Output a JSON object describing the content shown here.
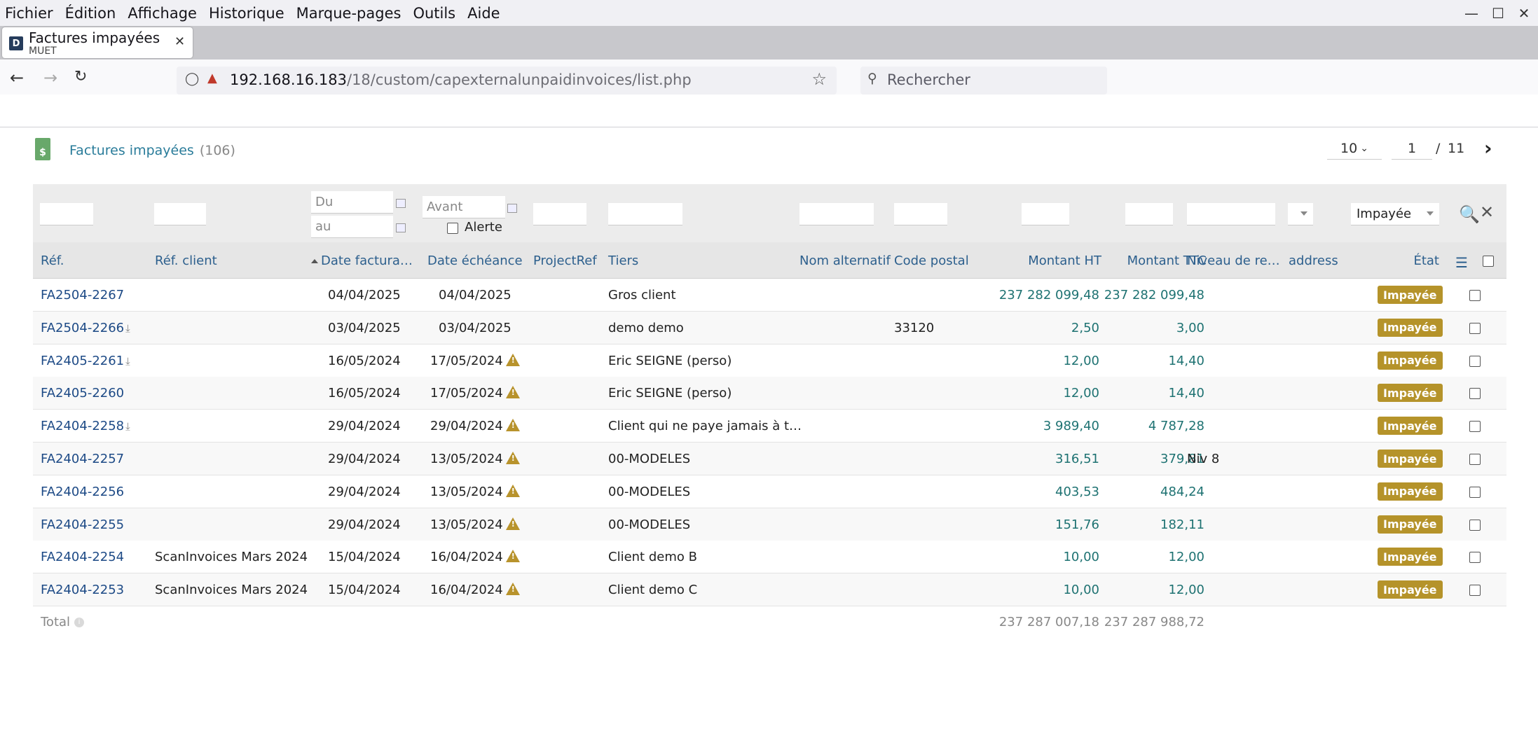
{
  "browser": {
    "menu": [
      "Fichier",
      "Édition",
      "Affichage",
      "Historique",
      "Marque-pages",
      "Outils",
      "Aide"
    ],
    "tab": {
      "title": "Factures impayées",
      "subtitle": "MUET",
      "favicon": "D"
    },
    "url": {
      "host": "192.168.16.183",
      "path": "/18/custom/capexternalunpaidinvoices/list.php"
    },
    "search_placeholder": "Rechercher",
    "icons": [
      "back-icon",
      "forward-icon",
      "reload-icon",
      "shield-icon",
      "lock-icon",
      "star-icon",
      "search-icon",
      "minimize-icon",
      "maximize-icon",
      "close-icon"
    ]
  },
  "page": {
    "title": "Factures impayées",
    "count": "(106)",
    "pagination": {
      "limit": "10",
      "page": "1",
      "separator": "/",
      "total_pages": "11"
    }
  },
  "filters": {
    "date_from_placeholder": "Du",
    "date_to_placeholder": "au",
    "due_before_placeholder": "Avant",
    "alert_label": "Alerte",
    "status_value": "Impayée"
  },
  "columns": {
    "ref": "Réf.",
    "ref_client": "Réf. client",
    "date_invoice": "Date factura…",
    "date_due": "Date échéance",
    "project_ref": "ProjectRef",
    "thirdparty": "Tiers",
    "alt_name": "Nom alternatif",
    "zip": "Code postal",
    "amount_ht": "Montant HT",
    "amount_ttc": "Montant TTC",
    "level": "Niveau de re…",
    "address": "address",
    "status": "État"
  },
  "rows": [
    {
      "ref": "FA2504-2267",
      "download": false,
      "ref_client": "",
      "date_invoice": "04/04/2025",
      "date_due": "04/04/2025",
      "warn": false,
      "thirdparty": "Gros client",
      "zip": "",
      "amount_ht": "237 282 099,48",
      "amount_ttc": "237 282 099,48",
      "level": "",
      "status": "Impayée"
    },
    {
      "ref": "FA2504-2266",
      "download": true,
      "ref_client": "",
      "date_invoice": "03/04/2025",
      "date_due": "03/04/2025",
      "warn": false,
      "thirdparty": "demo demo",
      "zip": "33120",
      "amount_ht": "2,50",
      "amount_ttc": "3,00",
      "level": "",
      "status": "Impayée"
    },
    {
      "ref": "FA2405-2261",
      "download": true,
      "ref_client": "",
      "date_invoice": "16/05/2024",
      "date_due": "17/05/2024",
      "warn": true,
      "thirdparty": "Eric SEIGNE (perso)",
      "zip": "",
      "amount_ht": "12,00",
      "amount_ttc": "14,40",
      "level": "",
      "status": "Impayée"
    },
    {
      "ref": "FA2405-2260",
      "download": false,
      "ref_client": "",
      "date_invoice": "16/05/2024",
      "date_due": "17/05/2024",
      "warn": true,
      "thirdparty": "Eric SEIGNE (perso)",
      "zip": "",
      "amount_ht": "12,00",
      "amount_ttc": "14,40",
      "level": "",
      "status": "Impayée"
    },
    {
      "ref": "FA2404-2258",
      "download": true,
      "ref_client": "",
      "date_invoice": "29/04/2024",
      "date_due": "29/04/2024",
      "warn": true,
      "thirdparty": "Client qui ne paye jamais à t…",
      "zip": "",
      "amount_ht": "3 989,40",
      "amount_ttc": "4 787,28",
      "level": "",
      "status": "Impayée"
    },
    {
      "ref": "FA2404-2257",
      "download": false,
      "ref_client": "",
      "date_invoice": "29/04/2024",
      "date_due": "13/05/2024",
      "warn": true,
      "thirdparty": "00-MODELES",
      "zip": "",
      "amount_ht": "316,51",
      "amount_ttc": "379,81",
      "level": "Niv 8",
      "status": "Impayée"
    },
    {
      "ref": "FA2404-2256",
      "download": false,
      "ref_client": "",
      "date_invoice": "29/04/2024",
      "date_due": "13/05/2024",
      "warn": true,
      "thirdparty": "00-MODELES",
      "zip": "",
      "amount_ht": "403,53",
      "amount_ttc": "484,24",
      "level": "",
      "status": "Impayée"
    },
    {
      "ref": "FA2404-2255",
      "download": false,
      "ref_client": "",
      "date_invoice": "29/04/2024",
      "date_due": "13/05/2024",
      "warn": true,
      "thirdparty": "00-MODELES",
      "zip": "",
      "amount_ht": "151,76",
      "amount_ttc": "182,11",
      "level": "",
      "status": "Impayée"
    },
    {
      "ref": "FA2404-2254",
      "download": false,
      "ref_client": "ScanInvoices Mars 2024",
      "date_invoice": "15/04/2024",
      "date_due": "16/04/2024",
      "warn": true,
      "thirdparty": "Client demo B",
      "zip": "",
      "amount_ht": "10,00",
      "amount_ttc": "12,00",
      "level": "",
      "status": "Impayée"
    },
    {
      "ref": "FA2404-2253",
      "download": false,
      "ref_client": "ScanInvoices Mars 2024",
      "date_invoice": "15/04/2024",
      "date_due": "16/04/2024",
      "warn": true,
      "thirdparty": "Client demo C",
      "zip": "",
      "amount_ht": "10,00",
      "amount_ttc": "12,00",
      "level": "",
      "status": "Impayée"
    }
  ],
  "totals": {
    "label": "Total",
    "amount_ht": "237 287 007,18",
    "amount_ttc": "237 287 988,72"
  },
  "colors": {
    "link": "#1d4a86",
    "amount": "#1e7272",
    "badge": "#b5932a",
    "header_text": "#2c5f8d",
    "title": "#2a7c9a"
  }
}
